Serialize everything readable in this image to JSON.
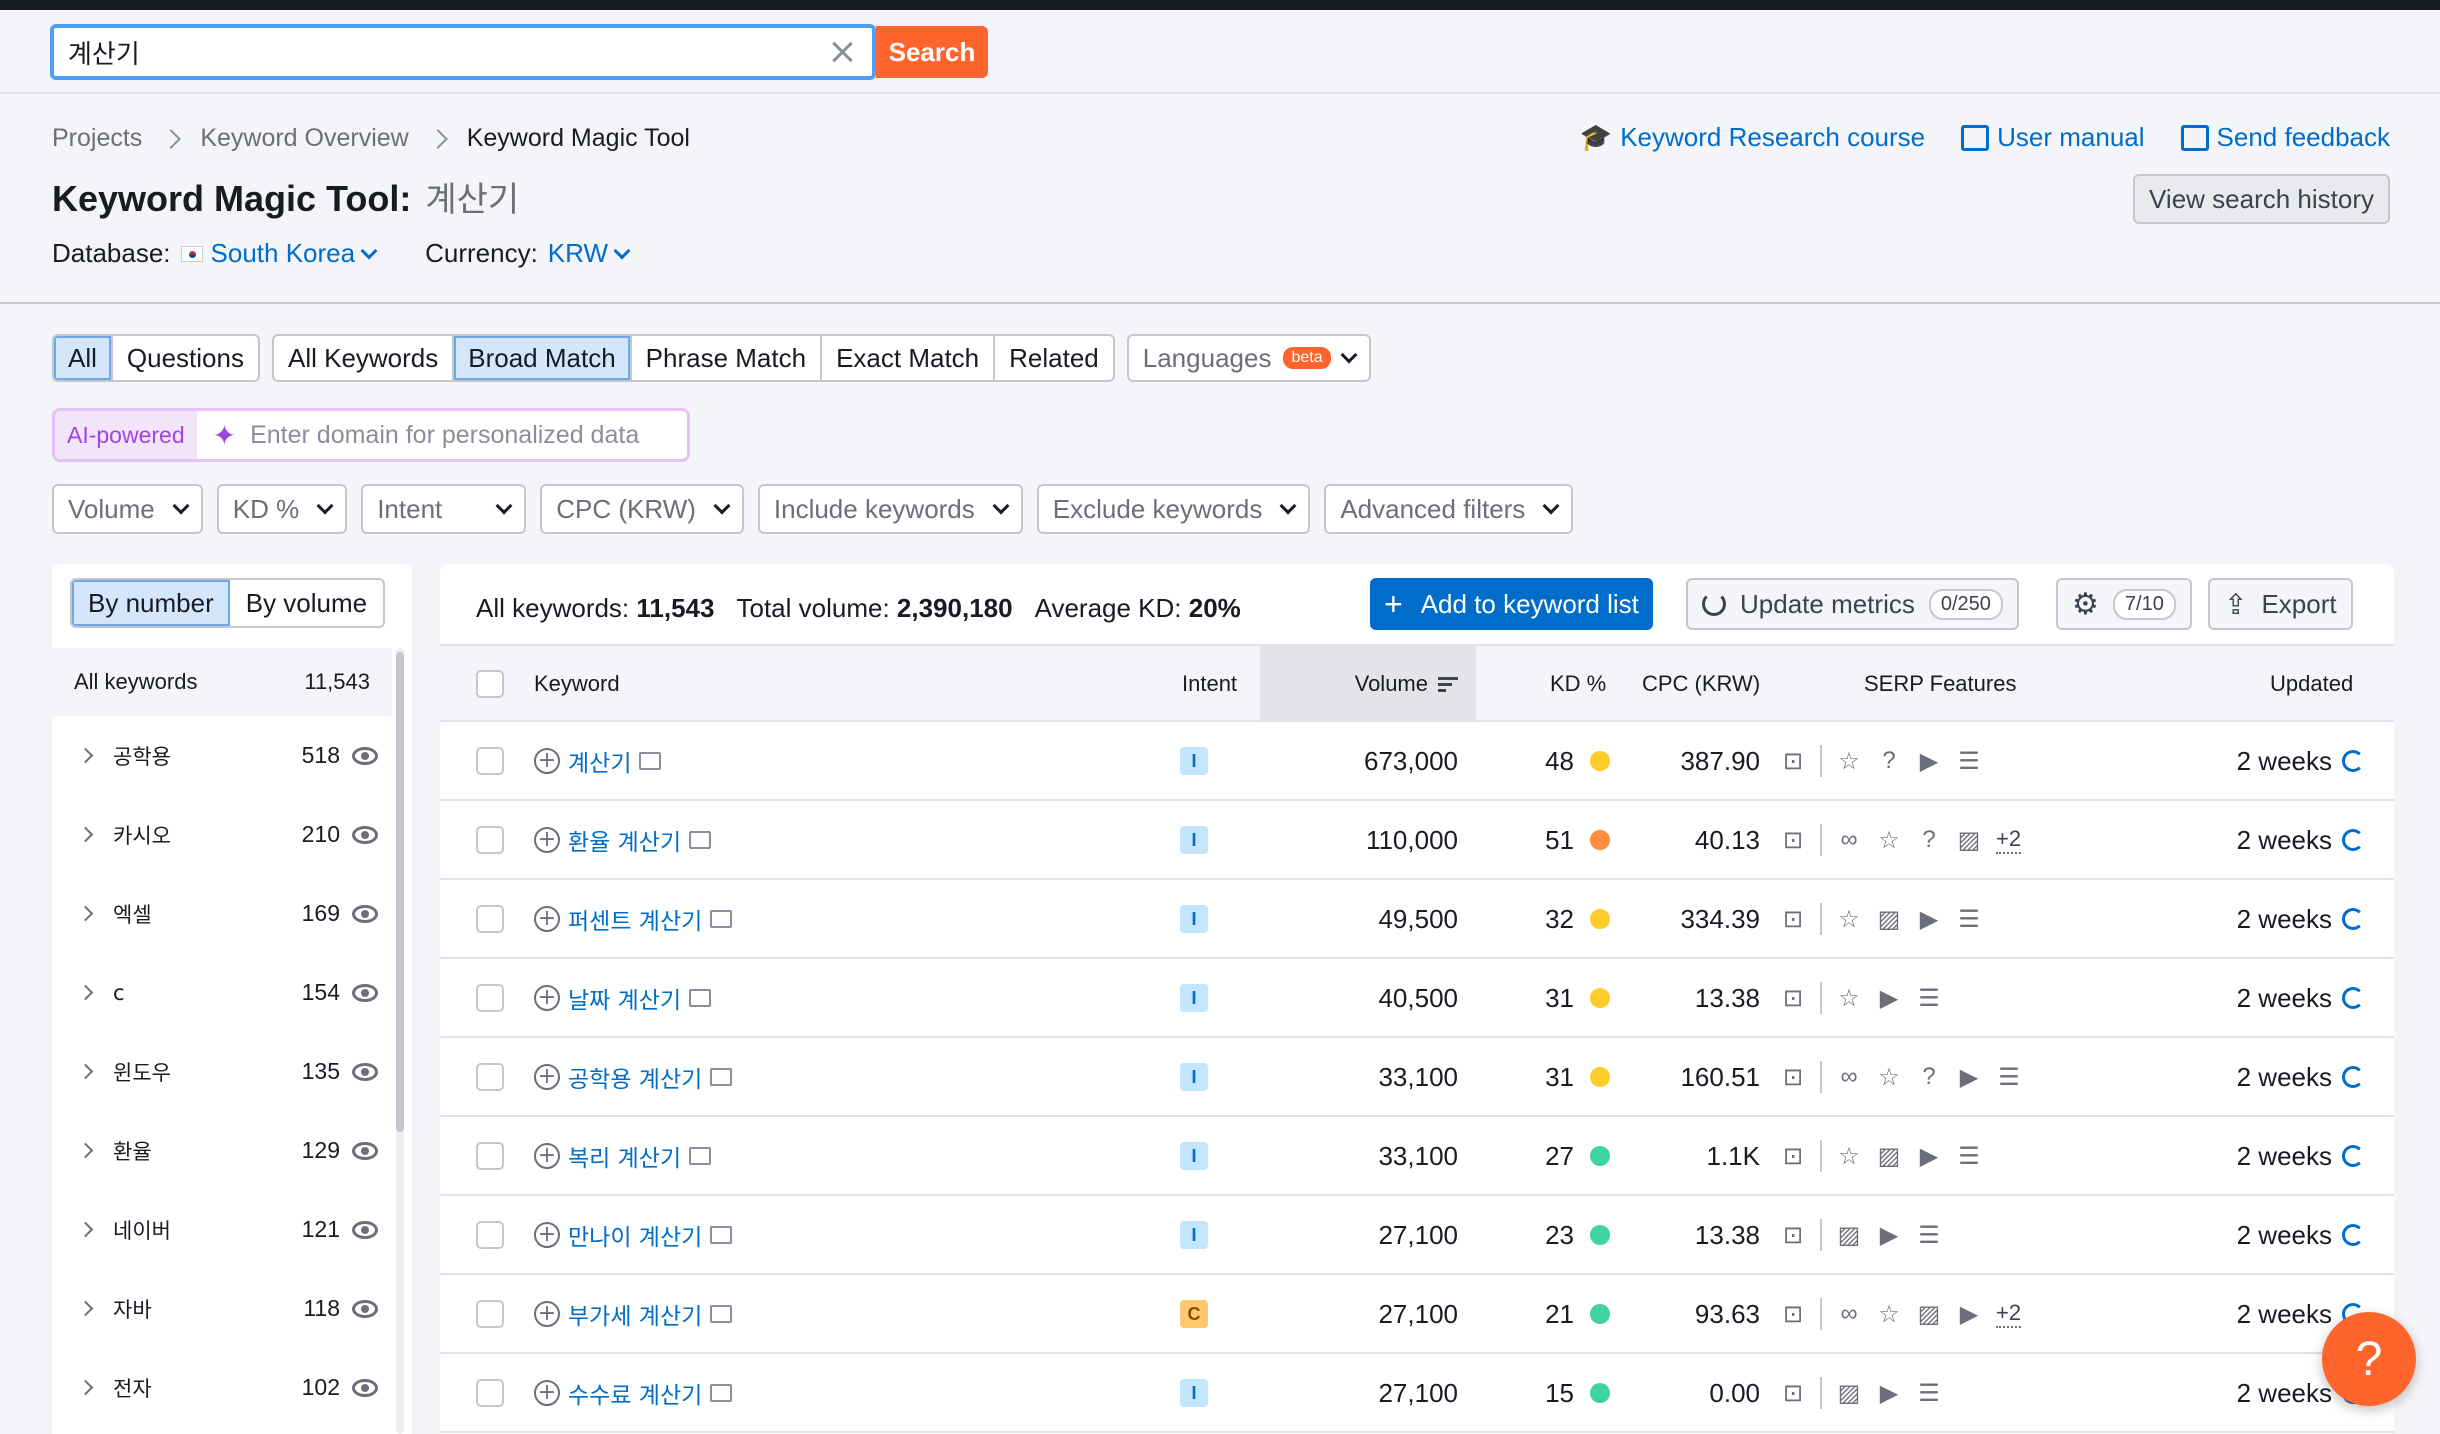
{
  "search": {
    "value": "계산기",
    "button": "Search"
  },
  "breadcrumb": [
    "Projects",
    "Keyword Overview",
    "Keyword Magic Tool"
  ],
  "title": {
    "label": "Keyword Magic Tool:",
    "keyword": "계산기"
  },
  "database": {
    "label": "Database:",
    "value": "South Korea"
  },
  "currency": {
    "label": "Currency:",
    "value": "KRW"
  },
  "toplinks": {
    "course": "Keyword Research course",
    "manual": "User manual",
    "feedback": "Send feedback"
  },
  "history_button": "View search history",
  "tabs": {
    "scope": [
      "All",
      "Questions"
    ],
    "match": [
      "All Keywords",
      "Broad Match",
      "Phrase Match",
      "Exact Match",
      "Related"
    ],
    "languages": "Languages",
    "beta": "beta"
  },
  "ai": {
    "label": "AI-powered",
    "placeholder": "Enter domain for personalized data"
  },
  "filters": [
    "Volume",
    "KD %",
    "Intent",
    "CPC (KRW)",
    "Include keywords",
    "Exclude keywords",
    "Advanced filters"
  ],
  "sidebar": {
    "toggle": [
      "By number",
      "By volume"
    ],
    "all": {
      "label": "All keywords",
      "count": "11,543"
    },
    "groups": [
      {
        "name": "공학용",
        "count": "518"
      },
      {
        "name": "카시오",
        "count": "210"
      },
      {
        "name": "엑셀",
        "count": "169"
      },
      {
        "name": "c",
        "count": "154"
      },
      {
        "name": "윈도우",
        "count": "135"
      },
      {
        "name": "환율",
        "count": "129"
      },
      {
        "name": "네이버",
        "count": "121"
      },
      {
        "name": "자바",
        "count": "118"
      },
      {
        "name": "전자",
        "count": "102"
      }
    ]
  },
  "summary": {
    "all_label": "All keywords:",
    "all_value": "11,543",
    "vol_label": "Total volume:",
    "vol_value": "2,390,180",
    "kd_label": "Average KD:",
    "kd_value": "20%"
  },
  "toolbar": {
    "add": "Add to keyword list",
    "update": "Update metrics",
    "update_count": "0/250",
    "columns": "7/10",
    "export": "Export"
  },
  "columns": {
    "keyword": "Keyword",
    "intent": "Intent",
    "volume": "Volume",
    "kd": "KD %",
    "cpc": "CPC (KRW)",
    "serp": "SERP Features",
    "updated": "Updated"
  },
  "colors": {
    "kd_yellow": "#ffcc29",
    "kd_orange": "#ff8c3b",
    "kd_green": "#3fd39f",
    "accent": "#006dca",
    "brand": "#ff642d"
  },
  "rows": [
    {
      "keyword": "계산기",
      "intent": "I",
      "volume": "673,000",
      "kd": "48",
      "kd_color": "#ffcc29",
      "cpc": "387.90",
      "serp": [
        "star-icon",
        "question-icon",
        "video-icon",
        "list-icon"
      ],
      "more": "",
      "updated": "2 weeks"
    },
    {
      "keyword": "환율 계산기",
      "intent": "I",
      "volume": "110,000",
      "kd": "51",
      "kd_color": "#ff8c3b",
      "cpc": "40.13",
      "serp": [
        "link-icon",
        "star-icon",
        "question-icon",
        "image-icon"
      ],
      "more": "+2",
      "updated": "2 weeks"
    },
    {
      "keyword": "퍼센트 계산기",
      "intent": "I",
      "volume": "49,500",
      "kd": "32",
      "kd_color": "#ffcc29",
      "cpc": "334.39",
      "serp": [
        "star-icon",
        "image-icon",
        "video-icon",
        "list-icon"
      ],
      "more": "",
      "updated": "2 weeks"
    },
    {
      "keyword": "날짜 계산기",
      "intent": "I",
      "volume": "40,500",
      "kd": "31",
      "kd_color": "#ffcc29",
      "cpc": "13.38",
      "serp": [
        "star-icon",
        "video-icon",
        "list-icon"
      ],
      "more": "",
      "updated": "2 weeks"
    },
    {
      "keyword": "공학용 계산기",
      "intent": "I",
      "volume": "33,100",
      "kd": "31",
      "kd_color": "#ffcc29",
      "cpc": "160.51",
      "serp": [
        "link-icon",
        "star-icon",
        "question-icon",
        "video-icon",
        "list-icon"
      ],
      "more": "",
      "updated": "2 weeks"
    },
    {
      "keyword": "복리 계산기",
      "intent": "I",
      "volume": "33,100",
      "kd": "27",
      "kd_color": "#3fd39f",
      "cpc": "1.1K",
      "serp": [
        "star-icon",
        "image-icon",
        "video-icon",
        "list-icon"
      ],
      "more": "",
      "updated": "2 weeks"
    },
    {
      "keyword": "만나이 계산기",
      "intent": "I",
      "volume": "27,100",
      "kd": "23",
      "kd_color": "#3fd39f",
      "cpc": "13.38",
      "serp": [
        "image-icon",
        "video-icon",
        "list-icon"
      ],
      "more": "",
      "updated": "2 weeks"
    },
    {
      "keyword": "부가세 계산기",
      "intent": "C",
      "volume": "27,100",
      "kd": "21",
      "kd_color": "#3fd39f",
      "cpc": "93.63",
      "serp": [
        "link-icon",
        "star-icon",
        "image-icon",
        "video-icon"
      ],
      "more": "+2",
      "updated": "2 weeks"
    },
    {
      "keyword": "수수료 계산기",
      "intent": "I",
      "volume": "27,100",
      "kd": "15",
      "kd_color": "#3fd39f",
      "cpc": "0.00",
      "serp": [
        "image-icon",
        "video-icon",
        "list-icon"
      ],
      "more": "",
      "updated": "2 weeks"
    }
  ],
  "help": "?"
}
